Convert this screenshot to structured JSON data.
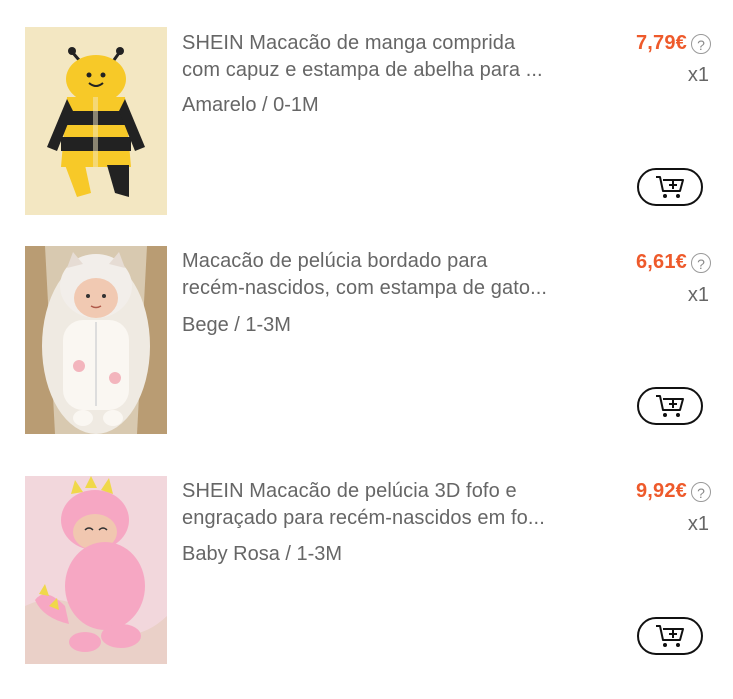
{
  "items": [
    {
      "title_line1": "SHEIN Macacão de manga comprida",
      "title_line2": "com capuz e estampa de abelha para ...",
      "variant": "Amarelo / 0-1M",
      "price": "7,79€",
      "quantity": "x1",
      "image": "bee-onesie-photo"
    },
    {
      "title_line1": "Macacão de pelúcia bordado para",
      "title_line2": "recém-nascidos, com estampa de gato...",
      "variant": "Bege / 1-3M",
      "price": "6,61€",
      "quantity": "x1",
      "image": "cat-onesie-photo"
    },
    {
      "title_line1": "SHEIN Macacão de pelúcia 3D fofo e",
      "title_line2": "engraçado para recém-nascidos em fo...",
      "variant": "Baby Rosa / 1-3M",
      "price": "9,92€",
      "quantity": "x1",
      "image": "dino-onesie-photo"
    }
  ],
  "icons": {
    "help": "question-circle-icon",
    "add_to_cart": "cart-plus-icon"
  },
  "colors": {
    "price": "#ee5a2b",
    "text_secondary": "#666666"
  }
}
